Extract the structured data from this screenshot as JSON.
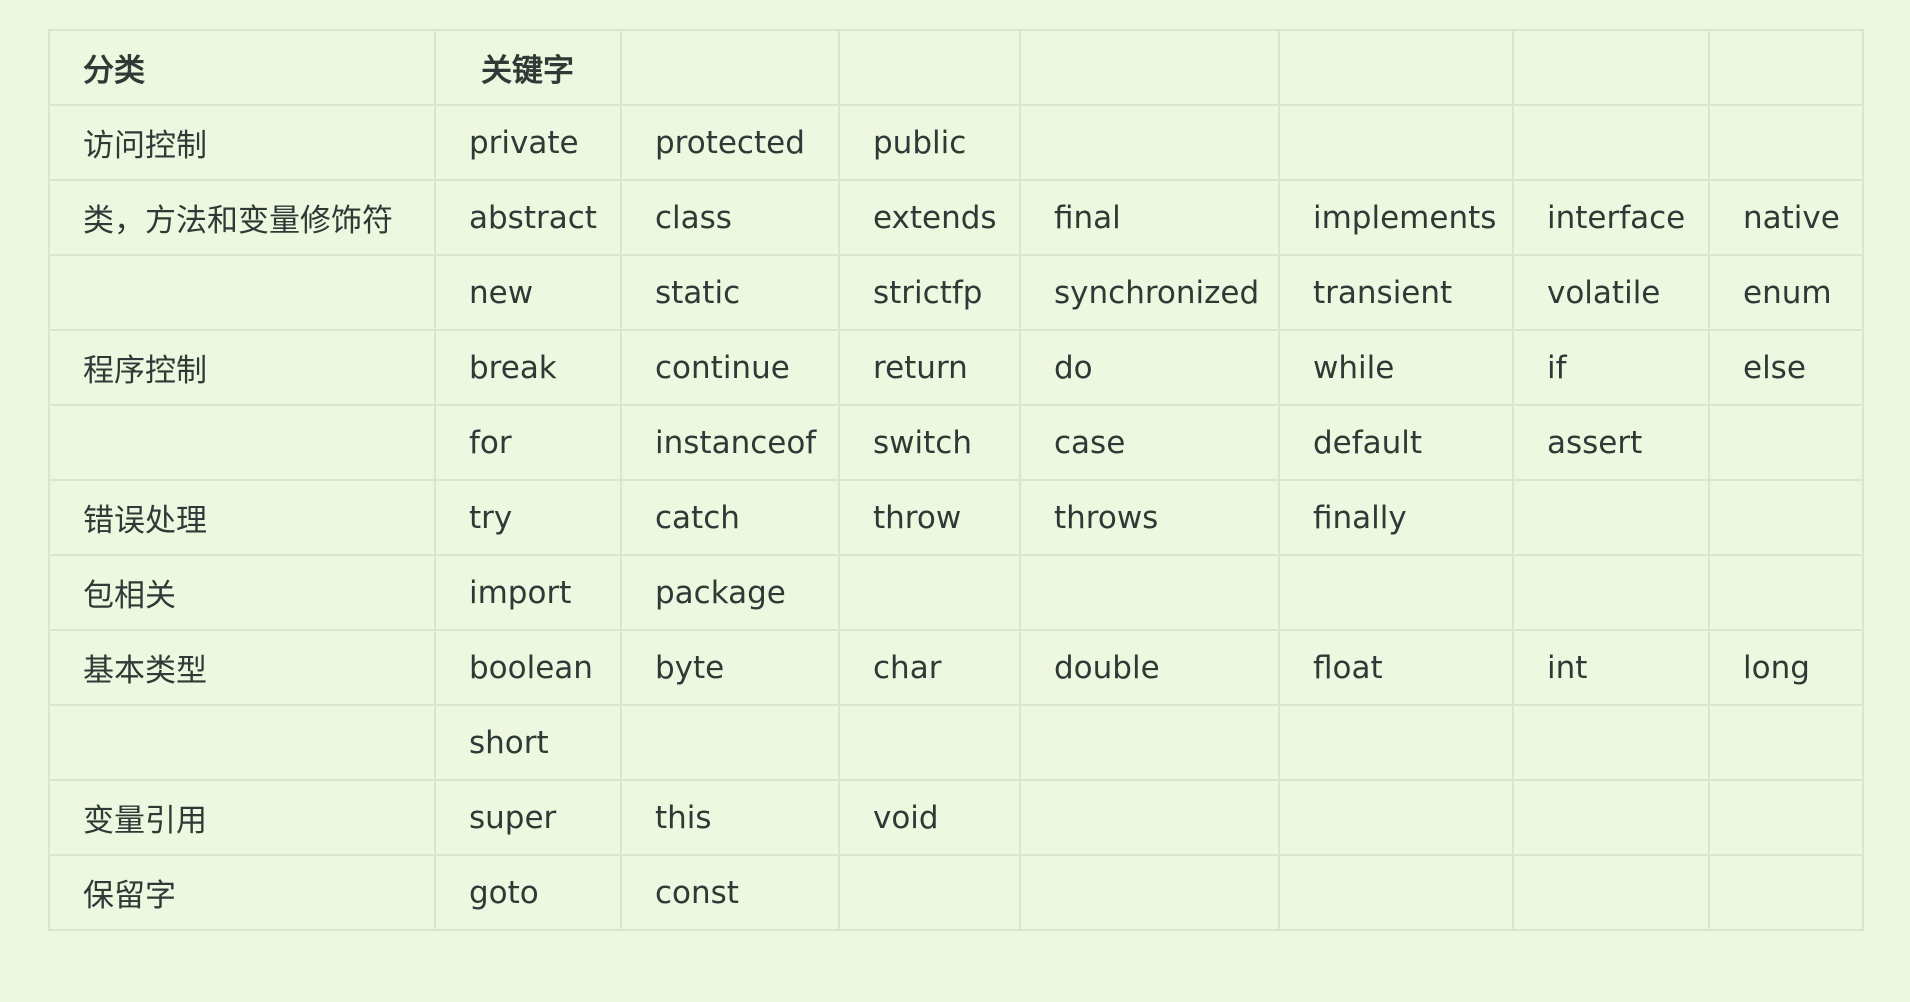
{
  "table": {
    "header": {
      "category": "分类",
      "keywords": "关键字"
    },
    "rows": [
      {
        "category": "访问控制",
        "keywords": [
          "private",
          "protected",
          "public",
          "",
          "",
          "",
          ""
        ]
      },
      {
        "category": "类，方法和变量修饰符",
        "keywords": [
          "abstract",
          "class",
          "extends",
          "final",
          "implements",
          "interface",
          "native"
        ]
      },
      {
        "category": "",
        "keywords": [
          "new",
          "static",
          "strictfp",
          "synchronized",
          "transient",
          "volatile",
          "enum"
        ]
      },
      {
        "category": "程序控制",
        "keywords": [
          "break",
          "continue",
          "return",
          "do",
          "while",
          "if",
          "else"
        ]
      },
      {
        "category": "",
        "keywords": [
          "for",
          "instanceof",
          "switch",
          "case",
          "default",
          "assert",
          ""
        ]
      },
      {
        "category": "错误处理",
        "keywords": [
          "try",
          "catch",
          "throw",
          "throws",
          "finally",
          "",
          ""
        ]
      },
      {
        "category": "包相关",
        "keywords": [
          "import",
          "package",
          "",
          "",
          "",
          "",
          ""
        ]
      },
      {
        "category": "基本类型",
        "keywords": [
          "boolean",
          "byte",
          "char",
          "double",
          "float",
          "int",
          "long"
        ]
      },
      {
        "category": "",
        "keywords": [
          "short",
          "",
          "",
          "",
          "",
          "",
          ""
        ]
      },
      {
        "category": "变量引用",
        "keywords": [
          "super",
          "this",
          "void",
          "",
          "",
          "",
          ""
        ]
      },
      {
        "category": "保留字",
        "keywords": [
          "goto",
          "const",
          "",
          "",
          "",
          "",
          ""
        ]
      }
    ]
  }
}
